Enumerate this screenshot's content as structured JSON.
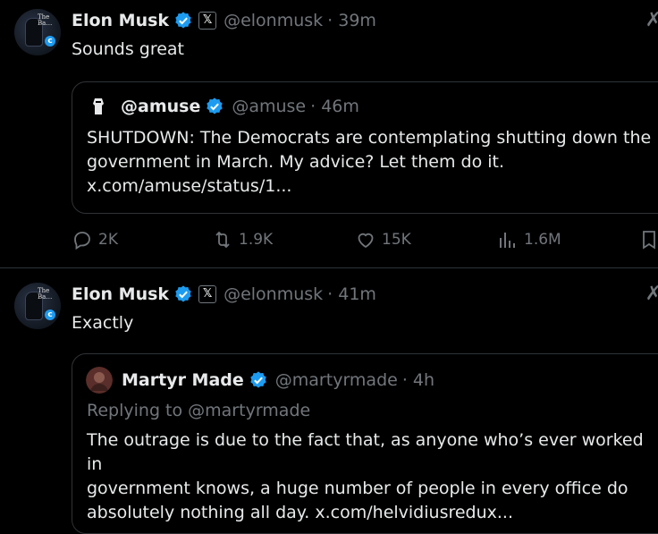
{
  "colors": {
    "background": "#000000",
    "text": "#e7e9ea",
    "muted": "#71767b",
    "verified": "#1d9bf0",
    "border": "#2f3336"
  },
  "tweets": [
    {
      "author": "Elon Musk",
      "handle": "@elonmusk",
      "time": "· 39m",
      "text": "Sounds great",
      "avatar_text": "The Ba…",
      "quote": {
        "author": "@amuse",
        "handle": "@amuse",
        "time": "· 46m",
        "lines": [
          "SHUTDOWN: The Democrats are contemplating shutting down the",
          "government in March. My advice? Let them do it.",
          "x.com/amuse/status/1..."
        ]
      },
      "actions": {
        "replies": "2K",
        "reposts": "1.9K",
        "likes": "15K",
        "views": "1.6M"
      }
    },
    {
      "author": "Elon Musk",
      "handle": "@elonmusk",
      "time": "· 41m",
      "text": "Exactly",
      "avatar_text": "The Ba…",
      "quote": {
        "author": "Martyr Made",
        "handle": "@martyrmade",
        "time": "· 4h",
        "replying_to": "Replying to @martyrmade",
        "lines": [
          "The outrage is due to the fact that, as anyone who’s ever worked in",
          "government knows, a huge number of people in every office do",
          "absolutely nothing all day. x.com/helvidiusredux..."
        ]
      }
    }
  ],
  "icons": [
    "verified-badge-icon",
    "x-logo-icon",
    "more-icon",
    "reply-icon",
    "repost-icon",
    "like-icon",
    "views-icon",
    "bookmark-icon"
  ]
}
